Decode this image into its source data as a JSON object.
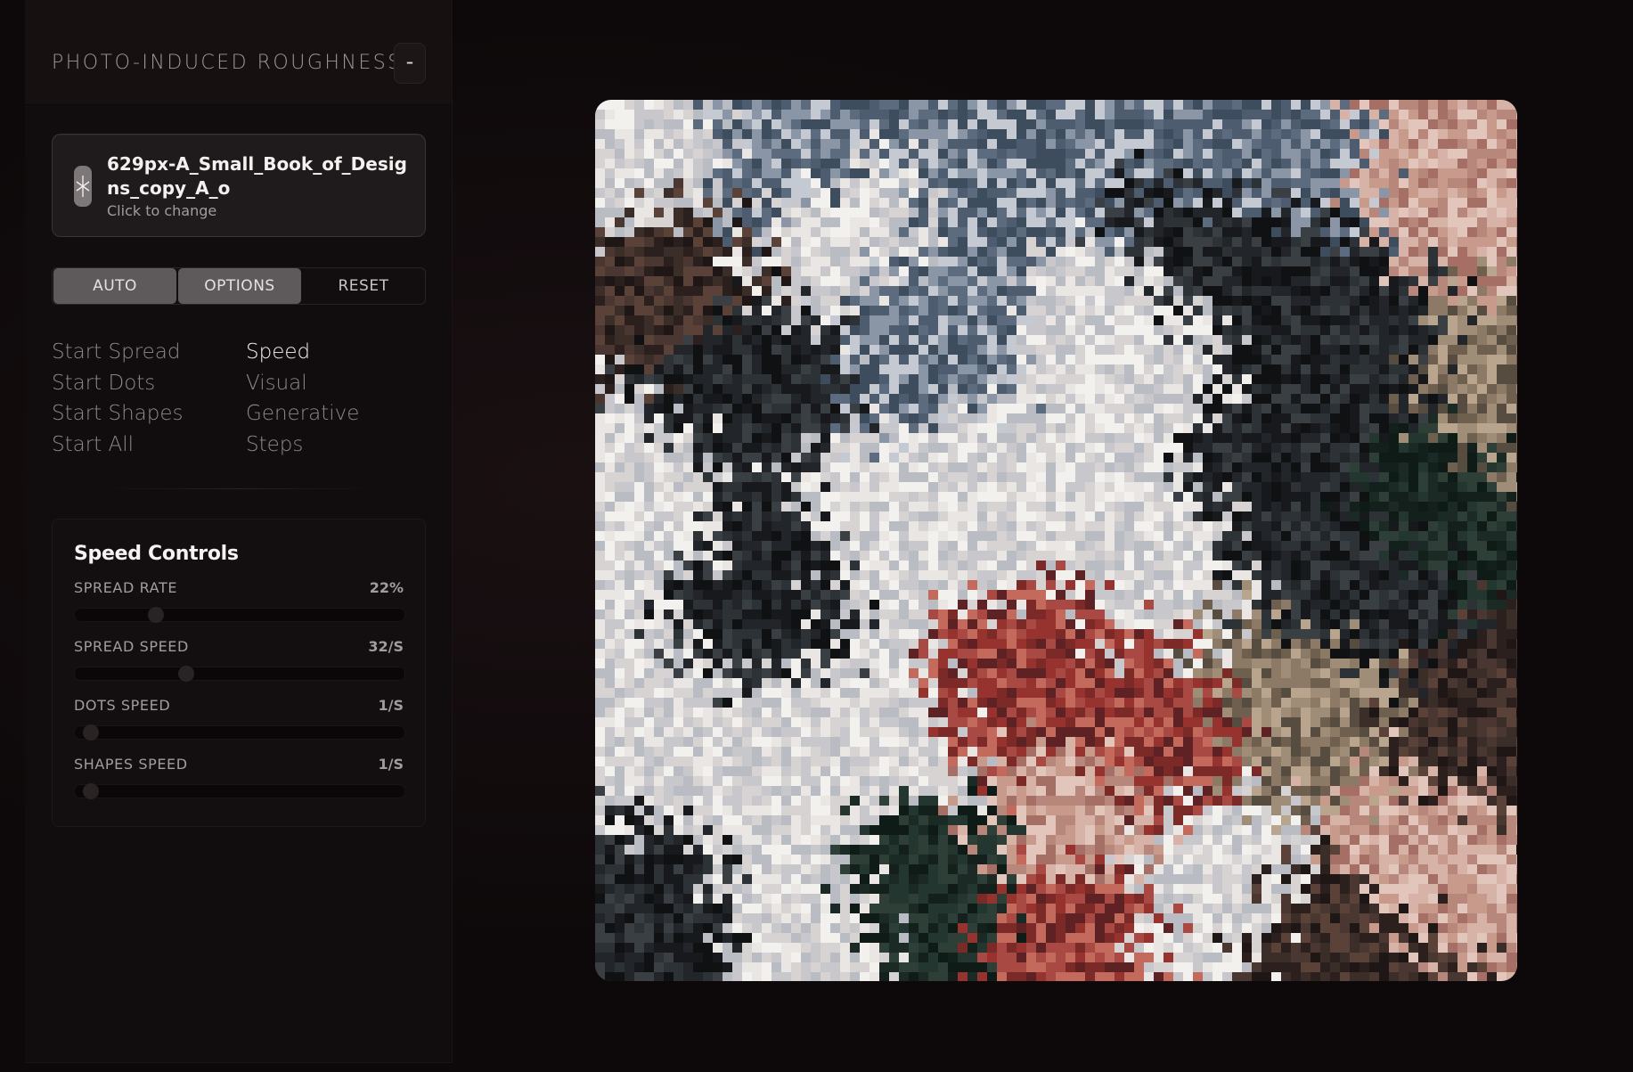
{
  "sidebar": {
    "title": "PHOTO-INDUCED ROUGHNESS",
    "collapse_label": "-",
    "image": {
      "name": "629px-A_Small_Book_of_Designs_copy_A_o",
      "hint": "Click to change"
    },
    "modes": [
      "AUTO",
      "OPTIONS",
      "RESET"
    ],
    "commands": [
      "Start Spread",
      "Start Dots",
      "Start Shapes",
      "Start All"
    ],
    "sections": [
      "Speed",
      "Visual",
      "Generative",
      "Steps"
    ]
  },
  "speed_panel": {
    "title": "Speed Controls",
    "controls": [
      {
        "label": "SPREAD RATE",
        "value": "22%",
        "level": 0.22
      },
      {
        "label": "SPREAD SPEED",
        "value": "32/S",
        "level": 0.32
      },
      {
        "label": "DOTS SPEED",
        "value": "1/S",
        "level": 0.0
      },
      {
        "label": "SHAPES SPEED",
        "value": "1/S",
        "level": 0.0
      }
    ]
  },
  "colors": {
    "accent_active": "#5e595a",
    "text_primary": "#f4f0f0",
    "text_muted": "#8f8889"
  }
}
